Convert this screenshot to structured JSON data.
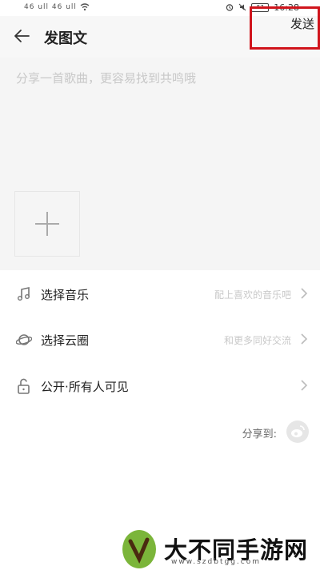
{
  "status_bar": {
    "signal_text": "46 ull 46 ull",
    "battery": "57",
    "time": "16:28"
  },
  "header": {
    "title": "发图文",
    "send_label": "发送",
    "back_icon": "arrow-left-icon"
  },
  "compose": {
    "placeholder": "分享一首歌曲，更容易找到共鸣哦",
    "add_icon": "plus-icon"
  },
  "options": [
    {
      "label": "选择音乐",
      "hint": "配上喜欢的音乐吧",
      "icon": "music-note-icon"
    },
    {
      "label": "选择云圈",
      "hint": "和更多同好交流",
      "icon": "planet-icon"
    },
    {
      "label": "公开·所有人可见",
      "hint": "",
      "icon": "unlock-icon"
    }
  ],
  "share": {
    "label": "分享到:",
    "icon": "weibo-icon"
  },
  "watermark": {
    "text": "大不同手游网",
    "url": "www.szdbtgg.com"
  },
  "colors": {
    "highlight_border": "#d0141c",
    "compose_bg": "#f5f5f5",
    "hint_text": "#c9c9c9"
  }
}
